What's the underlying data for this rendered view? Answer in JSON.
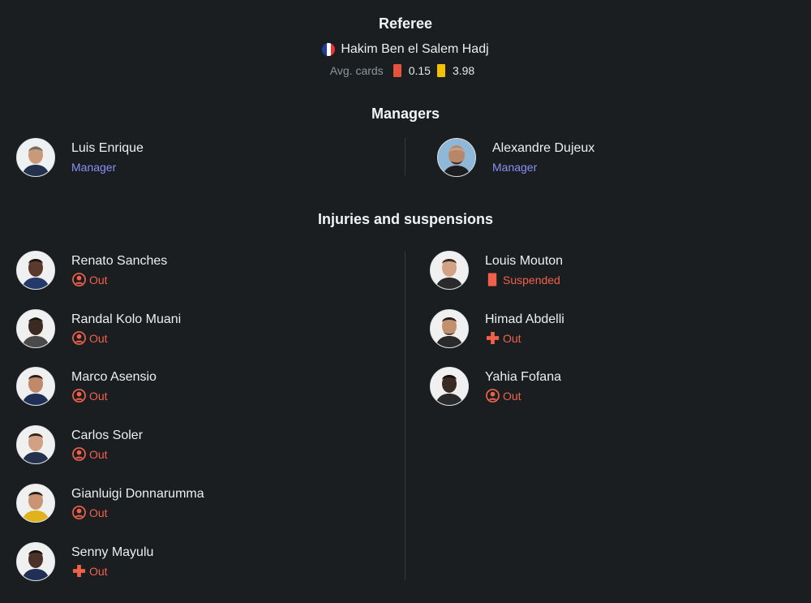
{
  "referee": {
    "title": "Referee",
    "name": "Hakim Ben el Salem Hadj",
    "flag_colors": [
      "#1f3d9c",
      "#ffffff",
      "#e8333b"
    ],
    "avg_cards_label": "Avg. cards",
    "red_avg": "0.15",
    "yellow_avg": "3.98",
    "red_color": "#e5533e",
    "yellow_color": "#f2c200"
  },
  "managers": {
    "title": "Managers",
    "home": {
      "name": "Luis Enrique",
      "role": "Manager"
    },
    "away": {
      "name": "Alexandre Dujeux",
      "role": "Manager"
    }
  },
  "injuries": {
    "title": "Injuries and suspensions",
    "home": [
      {
        "name": "Renato Sanches",
        "status": "Out",
        "icon": "person-out-icon"
      },
      {
        "name": "Randal Kolo Muani",
        "status": "Out",
        "icon": "person-out-icon"
      },
      {
        "name": "Marco Asensio",
        "status": "Out",
        "icon": "person-out-icon"
      },
      {
        "name": "Carlos Soler",
        "status": "Out",
        "icon": "person-out-icon"
      },
      {
        "name": "Gianluigi Donnarumma",
        "status": "Out",
        "icon": "person-out-icon"
      },
      {
        "name": "Senny Mayulu",
        "status": "Out",
        "icon": "injury-cross-icon"
      }
    ],
    "away": [
      {
        "name": "Louis Mouton",
        "status": "Suspended",
        "icon": "red-card-icon"
      },
      {
        "name": "Himad Abdelli",
        "status": "Out",
        "icon": "injury-cross-icon"
      },
      {
        "name": "Yahia Fofana",
        "status": "Out",
        "icon": "person-out-icon"
      }
    ]
  },
  "colors": {
    "background": "#1b1e21",
    "status_red": "#f0614b",
    "manager_role": "#8a8ff5"
  }
}
